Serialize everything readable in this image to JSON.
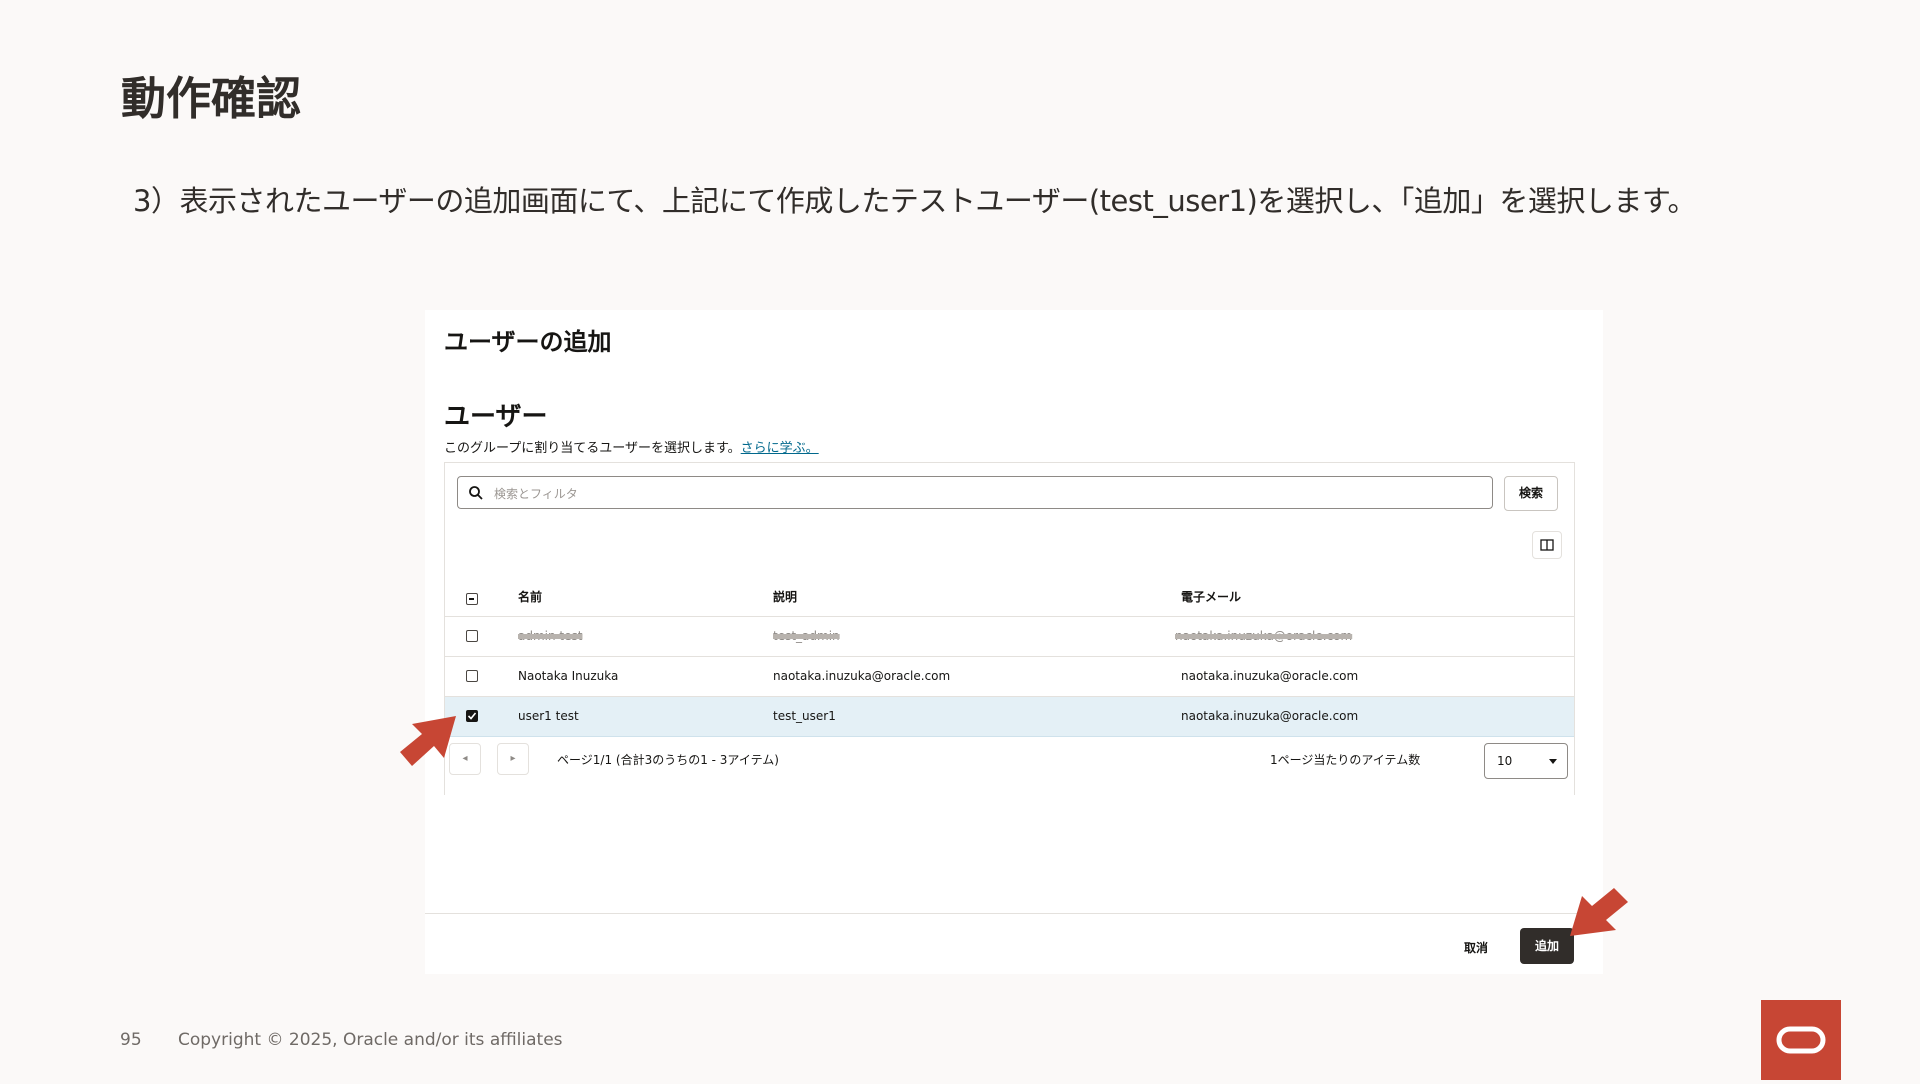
{
  "slide": {
    "title": "動作確認",
    "instruction": "3）表示されたユーザーの追加画面にて、上記にて作成したテストユーザー(test_user1)を選択し、「追加」を選択します。",
    "page_number": "95",
    "copyright": "Copyright © 2025, Oracle and/or its affiliates",
    "accent_color": "#c74634"
  },
  "dialog": {
    "title": "ユーザーの追加",
    "section_title": "ユーザー",
    "description": "このグループに割り当てるユーザーを選択します。",
    "learn_more_link": "さらに学ぶ。",
    "search": {
      "placeholder": "検索とフィルタ",
      "button_label": "検索",
      "icon": "search-icon"
    },
    "column_toggle_icon": "columns-icon",
    "table": {
      "columns": [
        "名前",
        "説明",
        "電子メール"
      ],
      "rows": [
        {
          "name": "admin test",
          "description": "test_admin",
          "email": "naotaka.inuzuka@oracle.com",
          "selected": false,
          "redacted": true
        },
        {
          "name": "Naotaka Inuzuka",
          "description": "naotaka.inuzuka@oracle.com",
          "email": "naotaka.inuzuka@oracle.com",
          "selected": false,
          "redacted": false
        },
        {
          "name": "user1 test",
          "description": "test_user1",
          "email": "naotaka.inuzuka@oracle.com",
          "selected": true,
          "redacted": false
        }
      ]
    },
    "pagination": {
      "prev_icon": "◂",
      "next_icon": "▸",
      "page_text": "ページ1/1 (合計3のうちの1 - 3アイテム)",
      "per_page_label": "1ページ当たりのアイテム数",
      "per_page_value": "10"
    },
    "cancel_label": "取消",
    "add_label": "追加"
  }
}
